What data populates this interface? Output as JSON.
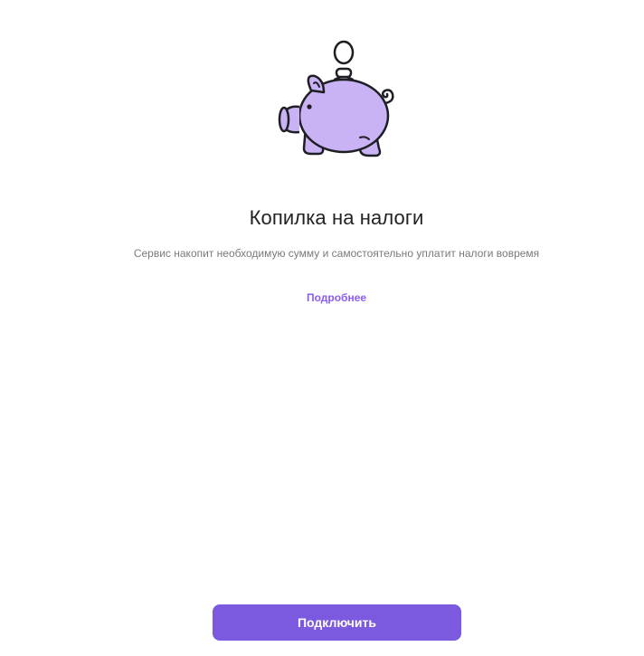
{
  "colors": {
    "accent": "#7c5ae0",
    "link": "#8b5cf6",
    "piggy_fill": "#c9b3f5",
    "outline": "#1e1e24"
  },
  "illustration": {
    "icon": "piggy-bank-icon"
  },
  "main": {
    "title": "Копилка на налоги",
    "subtitle": "Сервис накопит необходимую сумму и самостоятельно уплатит налоги вовремя",
    "more_link": "Подробнее"
  },
  "footer": {
    "connect_label": "Подключить"
  }
}
